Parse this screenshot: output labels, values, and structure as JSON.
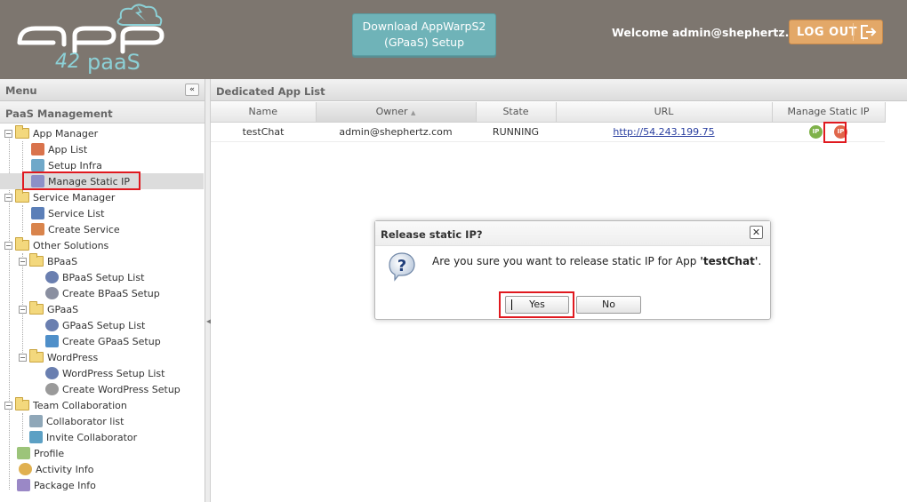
{
  "header": {
    "logo_text": "app 42 paas",
    "download_button": "Download AppWarpS2\n(GPaaS) Setup",
    "download_line1": "Download AppWarpS2",
    "download_line2": "(GPaaS) Setup",
    "welcome": "Welcome admin@shephertz.com",
    "logout_label": "LOG OUT"
  },
  "sidebar": {
    "title": "Menu",
    "collapse_icon": "double-chevron-left-icon",
    "section": "PaaS Management",
    "items": [
      {
        "label": "App Manager",
        "type": "folder"
      },
      {
        "label": "App List",
        "type": "leaf"
      },
      {
        "label": "Setup Infra",
        "type": "leaf"
      },
      {
        "label": "Manage Static IP",
        "type": "leaf",
        "selected": true
      },
      {
        "label": "Service Manager",
        "type": "folder"
      },
      {
        "label": "Service List",
        "type": "leaf"
      },
      {
        "label": "Create Service",
        "type": "leaf"
      },
      {
        "label": "Other Solutions",
        "type": "folder"
      },
      {
        "label": "BPaaS",
        "type": "folder"
      },
      {
        "label": "BPaaS Setup List",
        "type": "leaf"
      },
      {
        "label": "Create BPaaS Setup",
        "type": "leaf"
      },
      {
        "label": "GPaaS",
        "type": "folder"
      },
      {
        "label": "GPaaS Setup List",
        "type": "leaf"
      },
      {
        "label": "Create GPaaS Setup",
        "type": "leaf"
      },
      {
        "label": "WordPress",
        "type": "folder"
      },
      {
        "label": "WordPress Setup List",
        "type": "leaf"
      },
      {
        "label": "Create WordPress Setup",
        "type": "leaf"
      },
      {
        "label": "Team Collaboration",
        "type": "folder"
      },
      {
        "label": "Collaborator list",
        "type": "leaf"
      },
      {
        "label": "Invite Collaborator",
        "type": "leaf"
      },
      {
        "label": "Profile",
        "type": "leaf"
      },
      {
        "label": "Activity Info",
        "type": "leaf"
      },
      {
        "label": "Package Info",
        "type": "leaf"
      }
    ]
  },
  "main": {
    "title": "Dedicated App List",
    "columns": [
      "Name",
      "Owner",
      "State",
      "URL",
      "Manage Static IP"
    ],
    "sorted_column": "Owner",
    "rows": [
      {
        "name": "testChat",
        "owner": "admin@shephertz.com",
        "state": "RUNNING",
        "url": "http://54.243.199.75",
        "ip_icons": [
          "IP",
          "IP"
        ]
      }
    ]
  },
  "dialog": {
    "title": "Release static IP?",
    "message_prefix": "Are you sure you want to release static IP for App ",
    "app_name": "'testChat'",
    "message_suffix": ".",
    "yes_label": "Yes",
    "no_label": "No",
    "icon": "question-icon"
  },
  "colors": {
    "header_bg": "#7d766f",
    "download_btn": "#6fb3b8",
    "logout_btn": "#e3a868",
    "highlight": "#e0191f",
    "ip_assign": "#7fb24a",
    "ip_release": "#e0664a"
  }
}
